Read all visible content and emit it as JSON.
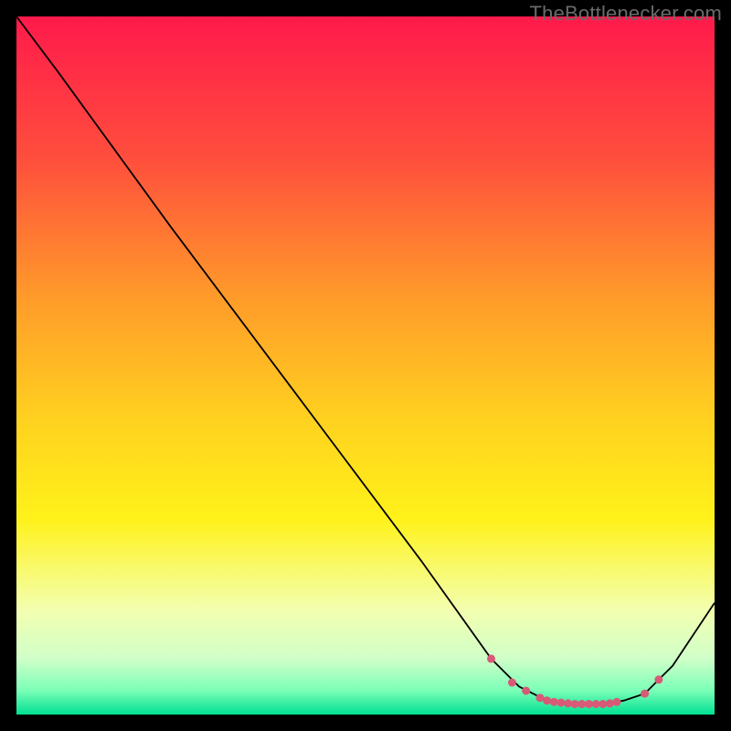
{
  "watermark": "TheBottlenecker.com",
  "chart_data": {
    "type": "line",
    "title": "",
    "xlabel": "",
    "ylabel": "",
    "xlim": [
      0,
      100
    ],
    "ylim": [
      0,
      100
    ],
    "grid": false,
    "series": [
      {
        "name": "curve",
        "x": [
          0,
          6,
          22,
          40,
          58,
          68,
          72,
          76,
          80,
          84,
          87,
          90,
          92,
          94,
          100
        ],
        "y": [
          100,
          92,
          70,
          46,
          22,
          8,
          4,
          2,
          1.5,
          1.5,
          2,
          3,
          5,
          7,
          16
        ],
        "color": "#000000",
        "linewidth": 1.2
      }
    ],
    "highlight_points": {
      "x": [
        68,
        71,
        73,
        75,
        76,
        77,
        78,
        79,
        80,
        81,
        82,
        83,
        84,
        85,
        86,
        90,
        92
      ],
      "y": [
        8,
        4.6,
        3.4,
        2.4,
        2.0,
        1.8,
        1.7,
        1.6,
        1.5,
        1.5,
        1.5,
        1.5,
        1.5,
        1.6,
        1.8,
        3,
        5
      ],
      "color": "#d85a77",
      "size": 9
    },
    "background_gradient": {
      "stops": [
        {
          "offset": 0.0,
          "color": "#ff1a4b"
        },
        {
          "offset": 0.2,
          "color": "#ff4d3d"
        },
        {
          "offset": 0.4,
          "color": "#ff9a2a"
        },
        {
          "offset": 0.58,
          "color": "#ffd21f"
        },
        {
          "offset": 0.72,
          "color": "#fff21a"
        },
        {
          "offset": 0.85,
          "color": "#f3ffb0"
        },
        {
          "offset": 0.92,
          "color": "#d0ffc8"
        },
        {
          "offset": 0.965,
          "color": "#7cffb8"
        },
        {
          "offset": 1.0,
          "color": "#00e092"
        }
      ]
    }
  }
}
